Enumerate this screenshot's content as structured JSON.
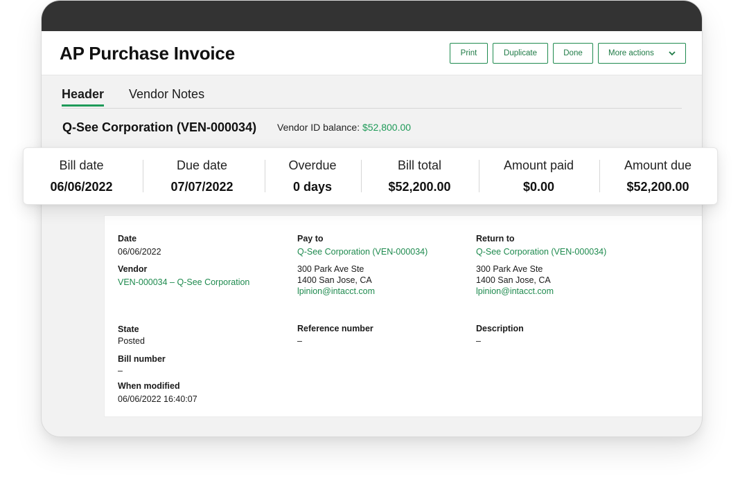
{
  "header": {
    "title": "AP Purchase Invoice",
    "buttons": {
      "print": "Print",
      "duplicate": "Duplicate",
      "done": "Done",
      "more": "More actions"
    }
  },
  "tabs": [
    {
      "label": "Header"
    },
    {
      "label": "Vendor Notes"
    }
  ],
  "vendor": {
    "name": "Q-See Corporation (VEN-000034)",
    "balance_label": "Vendor ID balance:",
    "balance_value": "$52,800.00"
  },
  "summary": [
    {
      "label": "Bill date",
      "value": "06/06/2022"
    },
    {
      "label": "Due date",
      "value": "07/07/2022"
    },
    {
      "label": "Overdue",
      "value": "0 days"
    },
    {
      "label": "Bill total",
      "value": "$52,200.00"
    },
    {
      "label": "Amount paid",
      "value": "$0.00"
    },
    {
      "label": "Amount due",
      "value": "$52,200.00"
    }
  ],
  "details": {
    "date": {
      "label": "Date",
      "value": "06/06/2022"
    },
    "vendor": {
      "label": "Vendor",
      "value": "VEN-000034 – Q-See Corporation"
    },
    "pay_to": {
      "label": "Pay to",
      "name": "Q-See Corporation (VEN-000034)",
      "address1": "300 Park Ave Ste",
      "address2": "1400 San Jose, CA",
      "email": "lpinion@intacct.com"
    },
    "return_to": {
      "label": "Return to",
      "name": "Q-See Corporation (VEN-000034)",
      "address1": "300 Park Ave Ste",
      "address2": "1400 San Jose, CA",
      "email": "lpinion@intacct.com"
    },
    "state": {
      "label": "State",
      "value": "Posted"
    },
    "bill_number": {
      "label": "Bill number",
      "value": "–"
    },
    "when_modified": {
      "label": "When modified",
      "value": "06/06/2022 16:40:07"
    },
    "reference_number": {
      "label": "Reference number",
      "value": "–"
    },
    "description": {
      "label": "Description",
      "value": "–"
    }
  },
  "colors": {
    "accent": "#1e9a58",
    "topbar": "#333333"
  },
  "icons": {
    "more_actions": "chevron-down-icon"
  }
}
